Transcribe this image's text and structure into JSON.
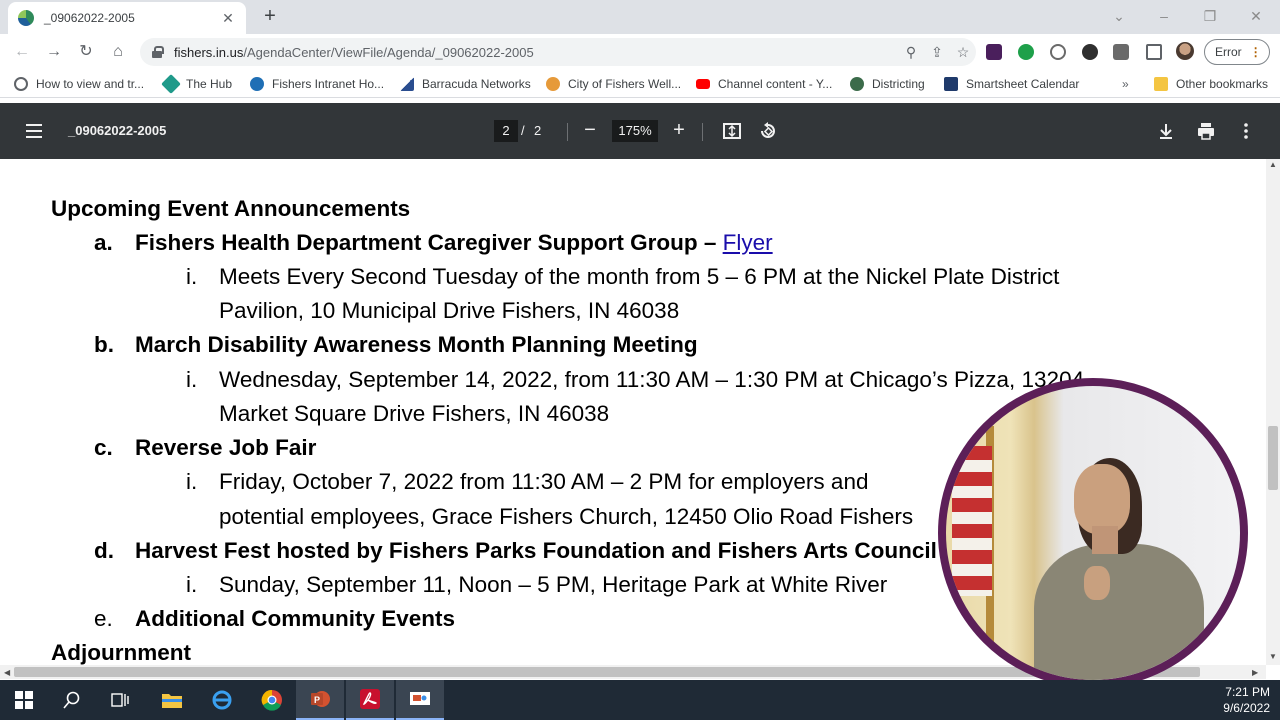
{
  "browser": {
    "tab_title": "_09062022-2005",
    "url_host": "fishers.in.us",
    "url_path": "/AgendaCenter/ViewFile/Agenda/_09062022-2005",
    "profile_status": "Error"
  },
  "bookmarks": [
    {
      "label": "How to view and tr...",
      "icon": "globe-icon",
      "color": "#5f6368"
    },
    {
      "label": "The Hub",
      "icon": "hub-icon",
      "color": "#1f9a8a"
    },
    {
      "label": "Fishers Intranet Ho...",
      "icon": "sharepoint-icon",
      "color": "#1f6fb5"
    },
    {
      "label": "Barracuda Networks",
      "icon": "barracuda-icon",
      "color": "#2a4d8f"
    },
    {
      "label": "City of Fishers Well...",
      "icon": "wellness-icon",
      "color": "#e69a3a"
    },
    {
      "label": "Channel content - Y...",
      "icon": "youtube-icon",
      "color": "#ff0000"
    },
    {
      "label": "Districting",
      "icon": "districting-icon",
      "color": "#3b6b4a"
    },
    {
      "label": "Smartsheet Calendar",
      "icon": "smartsheet-icon",
      "color": "#1f3a6b"
    },
    {
      "label": "Other bookmarks",
      "icon": "folder-icon",
      "color": "#f4c542"
    }
  ],
  "pdf": {
    "title": "_09062022-2005",
    "current_page": "2",
    "page_separator": "/",
    "total_pages": "2",
    "zoom": "175%"
  },
  "document": {
    "lines": [
      {
        "kind": "h1",
        "marker": ".",
        "text": "Upcoming Event Announcements"
      },
      {
        "kind": "h2",
        "marker": "a.",
        "text": "Fishers Health Department Caregiver Support Group – ",
        "link": "Flyer"
      },
      {
        "kind": "body",
        "marker": "i.",
        "text": "Meets Every Second Tuesday of the month from 5 – 6 PM at the Nickel Plate District"
      },
      {
        "kind": "body",
        "marker": "",
        "text": "Pavilion, 10 Municipal Drive Fishers, IN 46038"
      },
      {
        "kind": "h2",
        "marker": "b.",
        "text": "March Disability Awareness Month Planning Meeting"
      },
      {
        "kind": "body",
        "marker": "i.",
        "text": "Wednesday, September 14, 2022, from 11:30 AM – 1:30 PM at Chicago’s Pizza, 13204"
      },
      {
        "kind": "body",
        "marker": "",
        "text": "Market Square Drive Fishers, IN 46038"
      },
      {
        "kind": "h2",
        "marker": "c.",
        "text": "Reverse Job Fair"
      },
      {
        "kind": "body",
        "marker": "i.",
        "text": "Friday, October 7, 2022 from 11:30 AM – 2 PM for employers and"
      },
      {
        "kind": "body",
        "marker": "",
        "text": "potential employees, Grace Fishers Church, 12450 Olio Road Fishers"
      },
      {
        "kind": "h2",
        "marker": "d.",
        "text": "Harvest Fest hosted by Fishers Parks Foundation and Fishers Arts Council"
      },
      {
        "kind": "body",
        "marker": "i.",
        "text": "Sunday, September 11, Noon – 5 PM, Heritage Park at White River"
      },
      {
        "kind": "h2",
        "marker": "e.",
        "text": "Additional Community Events"
      },
      {
        "kind": "h1",
        "marker": ".",
        "text": "Adjournment"
      }
    ]
  },
  "taskbar": {
    "time": "7:21 PM",
    "date": "9/6/2022",
    "apps": [
      {
        "name": "start-button"
      },
      {
        "name": "search-button"
      },
      {
        "name": "task-view-button"
      },
      {
        "name": "file-explorer-app"
      },
      {
        "name": "edge-app"
      },
      {
        "name": "chrome-app"
      },
      {
        "name": "powerpoint-app"
      },
      {
        "name": "acrobat-app"
      },
      {
        "name": "presentation-app"
      }
    ]
  },
  "colors": {
    "chrome_tabstrip": "#dee1e6",
    "pdf_toolbar": "#323639",
    "video_ring": "#5c1f58",
    "link": "#1a0dab",
    "taskbar": "#1f2a36"
  }
}
